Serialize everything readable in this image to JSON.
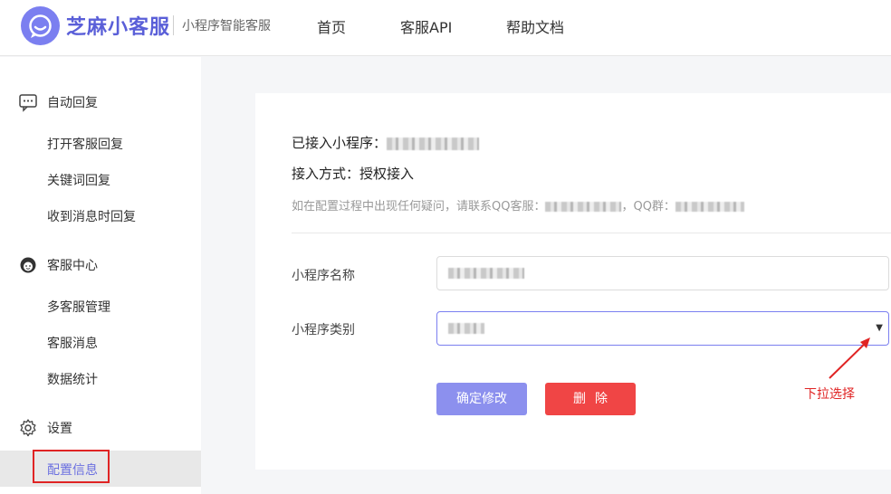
{
  "header": {
    "logo_text": "芝麻小客服",
    "logo_sub": "小程序智能客服",
    "nav": [
      {
        "label": "首页"
      },
      {
        "label": "客服API"
      },
      {
        "label": "帮助文档"
      }
    ]
  },
  "sidebar": {
    "groups": [
      {
        "label": "自动回复",
        "icon": "chat-icon",
        "items": [
          "打开客服回复",
          "关键词回复",
          "收到消息时回复"
        ]
      },
      {
        "label": "客服中心",
        "icon": "agent-icon",
        "items": [
          "多客服管理",
          "客服消息",
          "数据统计"
        ]
      },
      {
        "label": "设置",
        "icon": "gear-icon",
        "items": [
          "配置信息"
        ]
      }
    ],
    "active_item": "配置信息"
  },
  "main": {
    "connected_label": "已接入小程序：",
    "access_method": "接入方式：授权接入",
    "hint_prefix": "如在配置过程中出现任何疑问，请联系QQ客服：",
    "hint_group": "，QQ群：",
    "name_label": "小程序名称",
    "category_label": "小程序类别",
    "confirm_button": "确定修改",
    "delete_button": "删除"
  },
  "annotation": {
    "label": "下拉选择",
    "color": "#e02424"
  },
  "colors": {
    "brand": "#7b7ff0",
    "confirm": "#8c90ee",
    "danger": "#f04545"
  }
}
